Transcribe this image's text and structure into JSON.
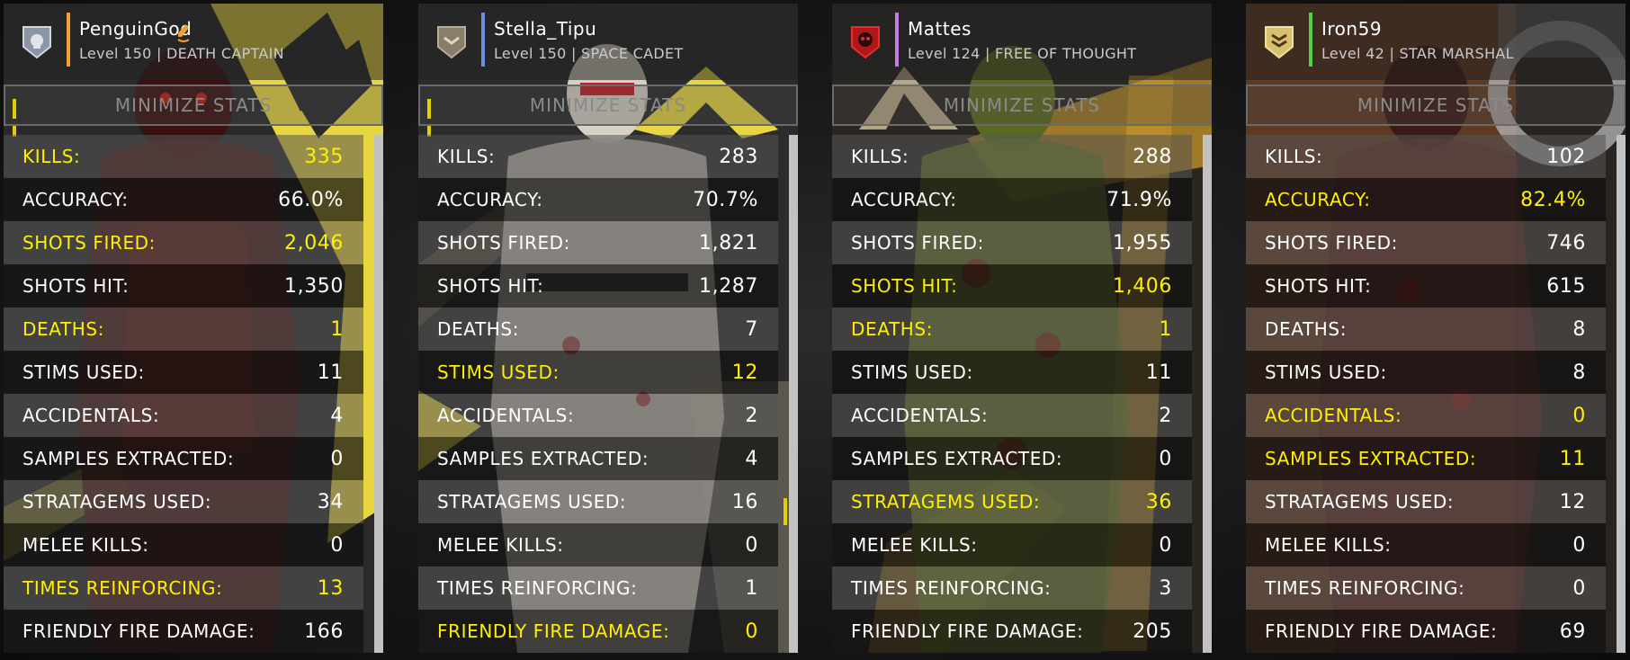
{
  "minimize_label": "MINIMIZE STATS",
  "colors": {
    "highlight": "#fff000",
    "text": "#ffffff"
  },
  "players": [
    {
      "name": "PenguinGod",
      "level": "Level 150 | DEATH CAPTAIN",
      "emblem": "shield-skull-icon",
      "accent": "#f0a030",
      "talking": true,
      "stats": [
        {
          "label": "KILLS:",
          "value": "335",
          "hl": true
        },
        {
          "label": "ACCURACY:",
          "value": "66.0%",
          "hl": false
        },
        {
          "label": "SHOTS FIRED:",
          "value": "2,046",
          "hl": true
        },
        {
          "label": "SHOTS HIT:",
          "value": "1,350",
          "hl": false
        },
        {
          "label": "DEATHS:",
          "value": "1",
          "hl": true
        },
        {
          "label": "STIMS USED:",
          "value": "11",
          "hl": false
        },
        {
          "label": "ACCIDENTALS:",
          "value": "4",
          "hl": false
        },
        {
          "label": "SAMPLES EXTRACTED:",
          "value": "0",
          "hl": false
        },
        {
          "label": "STRATAGEMS USED:",
          "value": "34",
          "hl": false
        },
        {
          "label": "MELEE KILLS:",
          "value": "0",
          "hl": false
        },
        {
          "label": "TIMES REINFORCING:",
          "value": "13",
          "hl": true
        },
        {
          "label": "FRIENDLY FIRE DAMAGE:",
          "value": "166",
          "hl": false
        }
      ]
    },
    {
      "name": "Stella_Tipu",
      "level": "Level 150 | SPACE CADET",
      "emblem": "shield-chevron-icon",
      "accent": "#6f8fe6",
      "talking": false,
      "stats": [
        {
          "label": "KILLS:",
          "value": "283",
          "hl": false
        },
        {
          "label": "ACCURACY:",
          "value": "70.7%",
          "hl": false
        },
        {
          "label": "SHOTS FIRED:",
          "value": "1,821",
          "hl": false
        },
        {
          "label": "SHOTS HIT:",
          "value": "1,287",
          "hl": false
        },
        {
          "label": "DEATHS:",
          "value": "7",
          "hl": false
        },
        {
          "label": "STIMS USED:",
          "value": "12",
          "hl": true
        },
        {
          "label": "ACCIDENTALS:",
          "value": "2",
          "hl": false
        },
        {
          "label": "SAMPLES EXTRACTED:",
          "value": "4",
          "hl": false
        },
        {
          "label": "STRATAGEMS USED:",
          "value": "16",
          "hl": false
        },
        {
          "label": "MELEE KILLS:",
          "value": "0",
          "hl": false
        },
        {
          "label": "TIMES REINFORCING:",
          "value": "1",
          "hl": false
        },
        {
          "label": "FRIENDLY FIRE DAMAGE:",
          "value": "0",
          "hl": true
        }
      ]
    },
    {
      "name": "Mattes",
      "level": "Level 124 | FREE OF THOUGHT",
      "emblem": "red-skull-icon",
      "accent": "#c77de0",
      "talking": false,
      "stats": [
        {
          "label": "KILLS:",
          "value": "288",
          "hl": false
        },
        {
          "label": "ACCURACY:",
          "value": "71.9%",
          "hl": false
        },
        {
          "label": "SHOTS FIRED:",
          "value": "1,955",
          "hl": false
        },
        {
          "label": "SHOTS HIT:",
          "value": "1,406",
          "hl": true
        },
        {
          "label": "DEATHS:",
          "value": "1",
          "hl": true
        },
        {
          "label": "STIMS USED:",
          "value": "11",
          "hl": false
        },
        {
          "label": "ACCIDENTALS:",
          "value": "2",
          "hl": false
        },
        {
          "label": "SAMPLES EXTRACTED:",
          "value": "0",
          "hl": false
        },
        {
          "label": "STRATAGEMS USED:",
          "value": "36",
          "hl": true
        },
        {
          "label": "MELEE KILLS:",
          "value": "0",
          "hl": false
        },
        {
          "label": "TIMES REINFORCING:",
          "value": "3",
          "hl": false
        },
        {
          "label": "FRIENDLY FIRE DAMAGE:",
          "value": "205",
          "hl": false
        }
      ]
    },
    {
      "name": "Iron59",
      "level": "Level 42 | STAR MARSHAL",
      "emblem": "shield-chevrons-gold-icon",
      "accent": "#55d04a",
      "talking": false,
      "stats": [
        {
          "label": "KILLS:",
          "value": "102",
          "hl": false
        },
        {
          "label": "ACCURACY:",
          "value": "82.4%",
          "hl": true
        },
        {
          "label": "SHOTS FIRED:",
          "value": "746",
          "hl": false
        },
        {
          "label": "SHOTS HIT:",
          "value": "615",
          "hl": false
        },
        {
          "label": "DEATHS:",
          "value": "8",
          "hl": false
        },
        {
          "label": "STIMS USED:",
          "value": "8",
          "hl": false
        },
        {
          "label": "ACCIDENTALS:",
          "value": "0",
          "hl": true
        },
        {
          "label": "SAMPLES EXTRACTED:",
          "value": "11",
          "hl": true
        },
        {
          "label": "STRATAGEMS USED:",
          "value": "12",
          "hl": false
        },
        {
          "label": "MELEE KILLS:",
          "value": "0",
          "hl": false
        },
        {
          "label": "TIMES REINFORCING:",
          "value": "0",
          "hl": false
        },
        {
          "label": "FRIENDLY FIRE DAMAGE:",
          "value": "69",
          "hl": false
        }
      ]
    }
  ]
}
